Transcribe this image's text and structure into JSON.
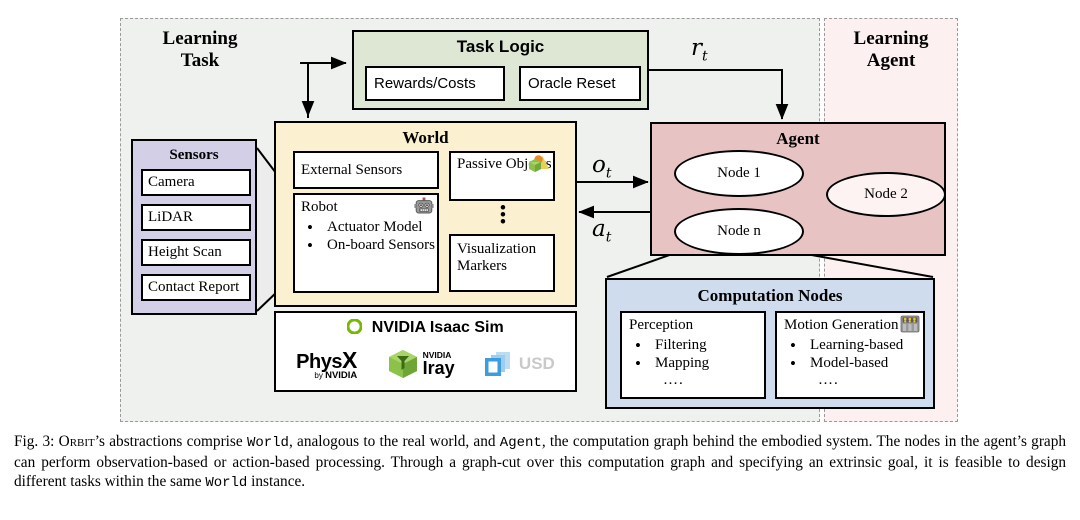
{
  "regions": {
    "task_label": "Learning\nTask",
    "agent_label": "Learning\nAgent",
    "task_color": "#eef1ee",
    "agent_color": "#fcf0f0"
  },
  "task_logic": {
    "title": "Task Logic",
    "color": "#dde7d4",
    "items": [
      "Rewards/Costs",
      "Oracle Reset"
    ]
  },
  "sensors": {
    "title": "Sensors",
    "color": "#d3cfe6",
    "items": [
      "Camera",
      "LiDAR",
      "Height Scan",
      "Contact Report"
    ]
  },
  "world": {
    "title": "World",
    "color": "#fbf0cf",
    "external_sensors": "External Sensors",
    "robot": {
      "title": "Robot",
      "bullets": [
        "Actuator Model",
        "On-board Sensors"
      ]
    },
    "passive_objects": "Passive Objects",
    "visualization_markers": "Visualization Markers",
    "ellipsis": "⋮"
  },
  "isaac": {
    "title": "NVIDIA Isaac Sim",
    "logos": [
      "PhysX by NVIDIA",
      "NVIDIA Iray",
      "USD"
    ],
    "physx_main": "Phys",
    "physx_x": "X",
    "physx_by": "by",
    "physx_nvidia": "NVIDIA",
    "iray_nvidia": "NVIDIA",
    "iray_main": "Iray",
    "usd_label": "USD"
  },
  "agent": {
    "title": "Agent",
    "color": "#e7c3c3",
    "nodes": [
      "Node 1",
      "Node 2",
      "Node n"
    ]
  },
  "computation": {
    "title": "Computation Nodes",
    "color": "#cfdcee",
    "groups": [
      {
        "title": "Perception",
        "bullets": [
          "Filtering",
          "Mapping"
        ],
        "more": "…."
      },
      {
        "title": "Motion Generation",
        "bullets": [
          "Learning-based",
          "Model-based"
        ],
        "more": "…."
      }
    ]
  },
  "signals": {
    "reward": "r",
    "observation": "o",
    "action": "a",
    "subscript": "t"
  },
  "caption": {
    "prefix": "Fig. 3: ",
    "orbit": "Orbit",
    "part1": "’s abstractions comprise ",
    "world": "World",
    "part2": ", analogous to the real world, and ",
    "agent": "Agent",
    "part3": ", the computation graph behind the embodied system. The nodes in the agent’s graph can perform observation-based or action-based processing. Through a graph-cut over this computation graph and specifying an extrinsic goal, it is feasible to design different tasks within the same ",
    "world2": "World",
    "part4": " instance."
  }
}
